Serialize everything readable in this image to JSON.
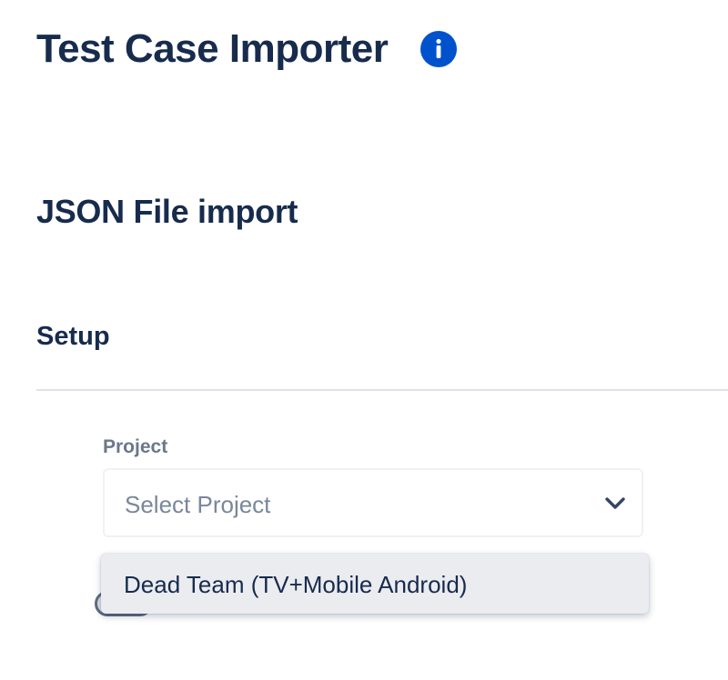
{
  "header": {
    "title": "Test Case Importer",
    "info_icon": "info-icon",
    "info_glyph": "i",
    "accent_color": "#0052cc"
  },
  "section": {
    "title": "JSON File import"
  },
  "setup": {
    "title": "Setup"
  },
  "project_field": {
    "label": "Project",
    "placeholder": "Select Project",
    "chevron_icon": "chevron-down-icon"
  },
  "project_dropdown": {
    "options": [
      {
        "label": "Dead Team (TV+Mobile Android)"
      }
    ]
  },
  "toggle": {
    "state": "off"
  }
}
